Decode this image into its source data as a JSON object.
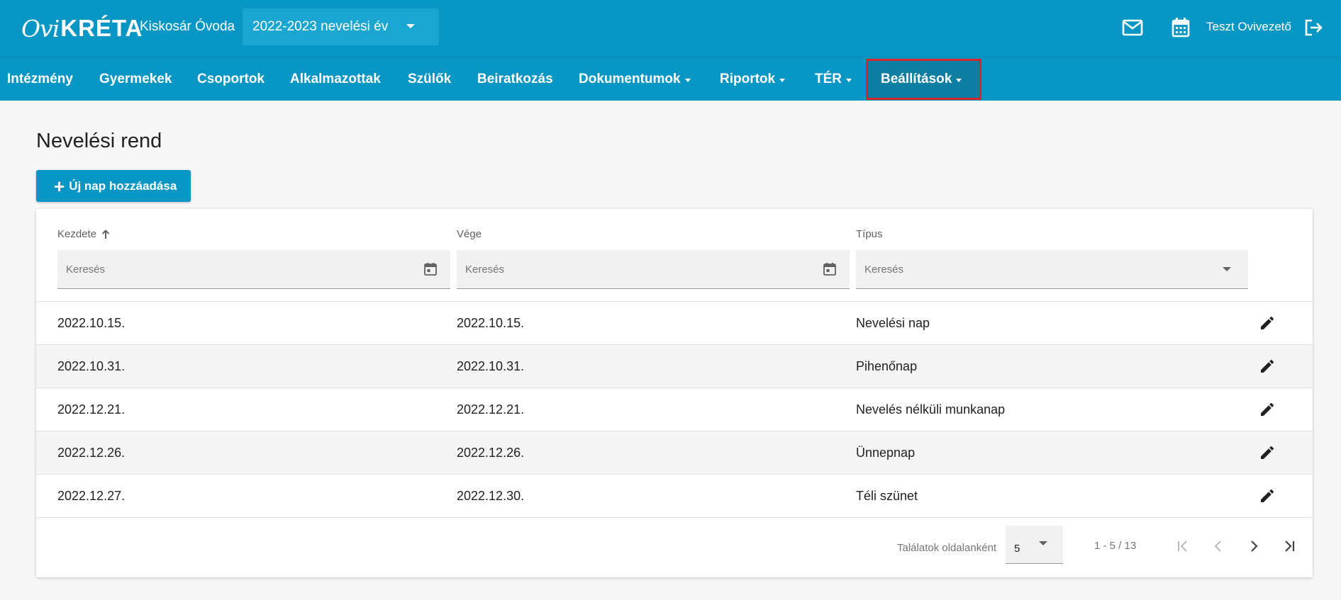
{
  "header": {
    "logo_ovi": "Ovi",
    "logo_kreta": "KRÉTA",
    "institution": "Kiskosár Óvoda",
    "year_select": {
      "value": "2022-2023 nevelési év"
    },
    "user_name": "Teszt Ovivezető",
    "icons": [
      "mail-icon",
      "calendar-icon",
      "logout-icon"
    ]
  },
  "nav": {
    "items": [
      {
        "label": "Intézmény",
        "dropdown": false
      },
      {
        "label": "Gyermekek",
        "dropdown": false
      },
      {
        "label": "Csoportok",
        "dropdown": false
      },
      {
        "label": "Alkalmazottak",
        "dropdown": false
      },
      {
        "label": "Szülők",
        "dropdown": false
      },
      {
        "label": "Beiratkozás",
        "dropdown": false
      },
      {
        "label": "Dokumentumok",
        "dropdown": true
      },
      {
        "label": "Riportok",
        "dropdown": true
      },
      {
        "label": "TÉR",
        "dropdown": true
      },
      {
        "label": "Beállítások",
        "dropdown": true,
        "active": true
      }
    ]
  },
  "main": {
    "title": "Nevelési rend",
    "add_button": "Új nap hozzáadása"
  },
  "table": {
    "columns": [
      {
        "label": "Kezdete",
        "sort": "ascending",
        "filter_placeholder": "Keresés",
        "filter_type": "date"
      },
      {
        "label": "Vége",
        "filter_placeholder": "Keresés",
        "filter_type": "date"
      },
      {
        "label": "Típus",
        "filter_placeholder": "Keresés",
        "filter_type": "select"
      }
    ],
    "rows": [
      {
        "start": "2022.10.15.",
        "end": "2022.10.15.",
        "type": "Nevelési nap"
      },
      {
        "start": "2022.10.31.",
        "end": "2022.10.31.",
        "type": "Pihenőnap"
      },
      {
        "start": "2022.12.21.",
        "end": "2022.12.21.",
        "type": "Nevelés nélküli munkanap"
      },
      {
        "start": "2022.12.26.",
        "end": "2022.12.26.",
        "type": "Ünnepnap"
      },
      {
        "start": "2022.12.27.",
        "end": "2022.12.30.",
        "type": "Téli szünet"
      }
    ],
    "footer": {
      "per_page_label": "Találatok oldalanként",
      "per_page_value": "5",
      "range": "1 - 5 / 13"
    }
  },
  "colors": {
    "primary": "#0897c4",
    "active_nav": "#0e7fa2",
    "highlight_border": "#d8232f",
    "row_alt": "#f5f5f5"
  }
}
